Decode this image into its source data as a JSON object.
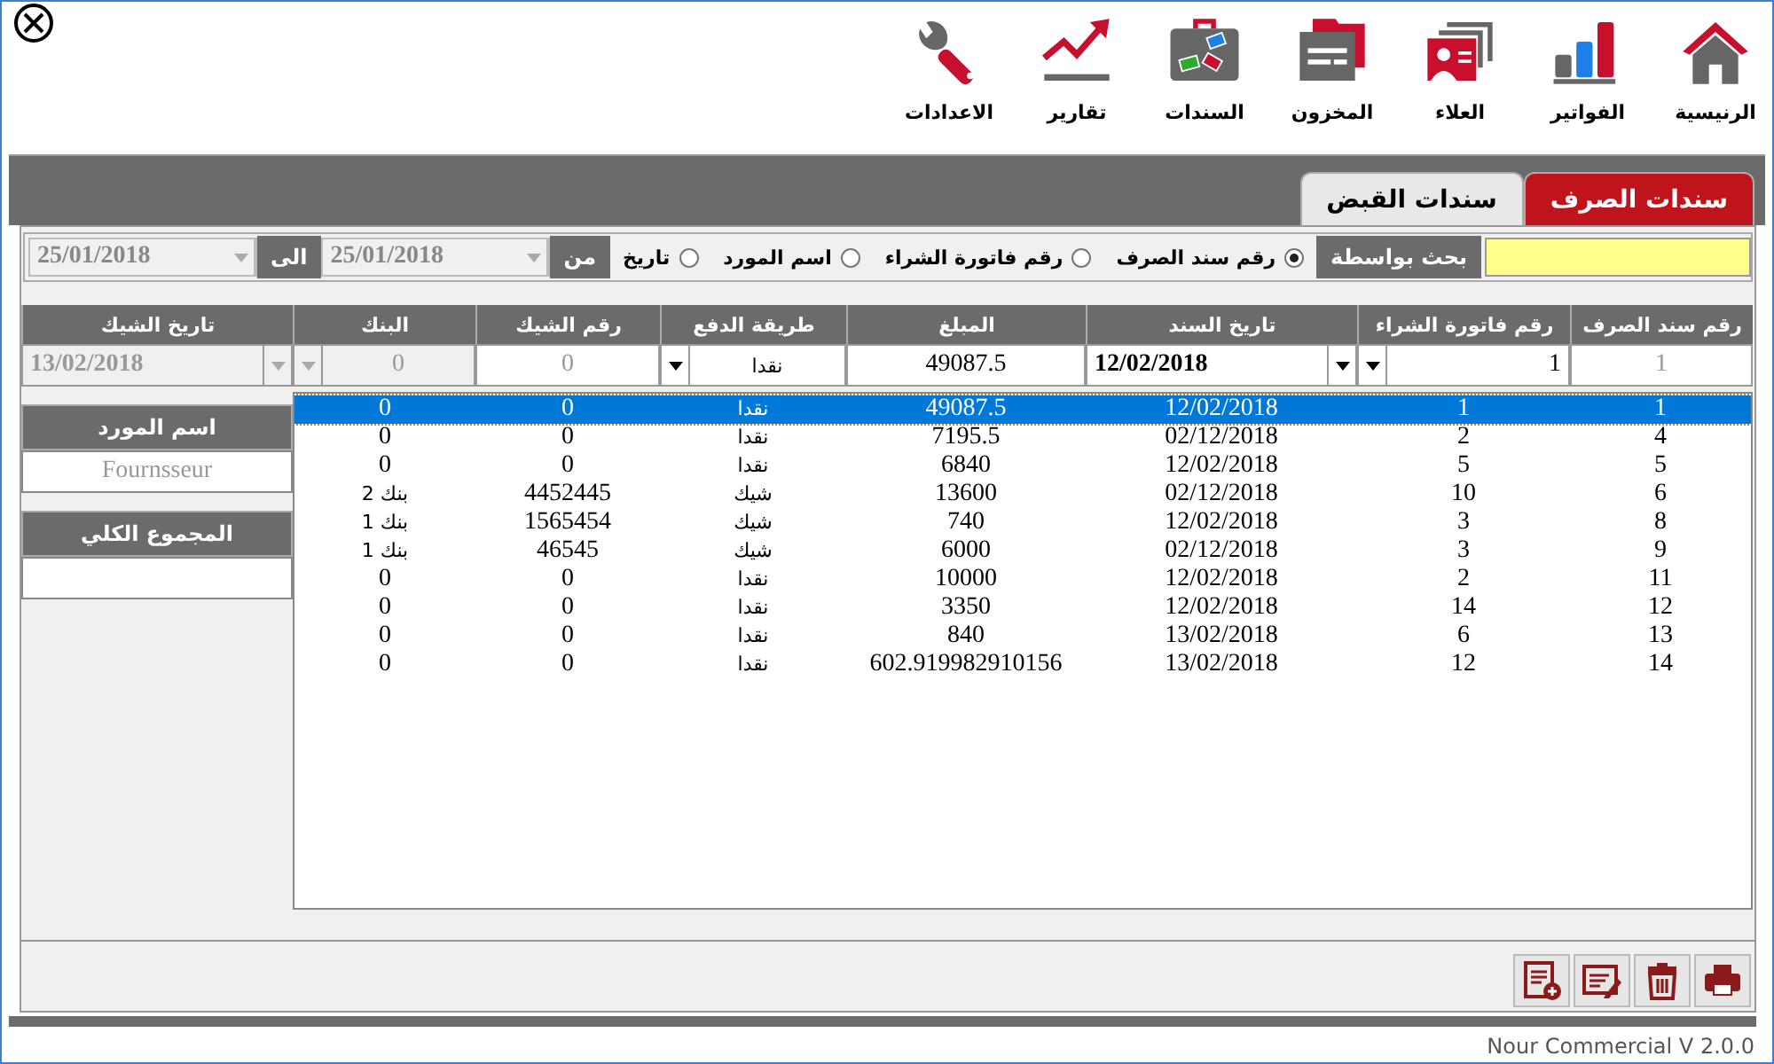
{
  "toolbar": [
    {
      "kind": "home",
      "label": "الرنيسية"
    },
    {
      "kind": "bars",
      "label": "الفواتير"
    },
    {
      "kind": "contact",
      "label": "العلاء"
    },
    {
      "kind": "folder",
      "label": "المخزون"
    },
    {
      "kind": "case",
      "label": "السندات"
    },
    {
      "kind": "trend",
      "label": "تقارير"
    },
    {
      "kind": "wrench",
      "label": "الاعدادات"
    }
  ],
  "tabs": [
    {
      "label": "سندات الصرف",
      "selected": true
    },
    {
      "label": "سندات القبض",
      "selected": false
    }
  ],
  "search": {
    "label": "بحث بواسطة",
    "options": [
      {
        "label": "رقم سند الصرف",
        "selected": true
      },
      {
        "label": "رقم فاتورة الشراء",
        "selected": false
      },
      {
        "label": "اسم المورد",
        "selected": false
      },
      {
        "label": "تاريخ",
        "selected": false
      }
    ],
    "from_label": "من",
    "from_date": "25/01/2018",
    "to_label": "الى",
    "to_date": "25/01/2018",
    "dates_disabled": true
  },
  "form": {
    "columns": [
      "رقم سند الصرف",
      "رقم فاتورة الشراء",
      "تاريخ السند",
      "المبلغ",
      "طريقة الدفع",
      "رقم الشيك",
      "البنك",
      "تاريخ الشيك"
    ],
    "fields": [
      {
        "kind": "text",
        "value": "1",
        "disabled": true
      },
      {
        "kind": "combo",
        "value": "1",
        "disabled": false
      },
      {
        "kind": "combo",
        "value": "12/02/2018",
        "disabled": false
      },
      {
        "kind": "text",
        "value": "49087.5",
        "disabled": false
      },
      {
        "kind": "combo",
        "value": "نقدا",
        "disabled": false
      },
      {
        "kind": "text",
        "value": "0",
        "disabled": true
      },
      {
        "kind": "combo",
        "value": "0",
        "disabled": true
      },
      {
        "kind": "combo",
        "value": "13/02/2018",
        "disabled": true
      }
    ]
  },
  "side": [
    {
      "label": "اسم المورد",
      "placeholder": "Fournsseur"
    },
    {
      "label": "المجموع الكلي"
    }
  ],
  "table": {
    "rows": [
      {
        "selected": true,
        "cells": [
          "1",
          "1",
          "12/02/2018",
          "49087.5",
          "نقدا",
          "0",
          "0"
        ]
      },
      {
        "selected": false,
        "cells": [
          "4",
          "2",
          "02/12/2018",
          "7195.5",
          "نقدا",
          "0",
          "0"
        ]
      },
      {
        "selected": false,
        "cells": [
          "5",
          "5",
          "12/02/2018",
          "6840",
          "نقدا",
          "0",
          "0"
        ]
      },
      {
        "selected": false,
        "cells": [
          "6",
          "10",
          "02/12/2018",
          "13600",
          "شيك",
          "4452445",
          "بنك 2"
        ]
      },
      {
        "selected": false,
        "cells": [
          "8",
          "3",
          "12/02/2018",
          "740",
          "شيك",
          "1565454",
          "بنك 1"
        ]
      },
      {
        "selected": false,
        "cells": [
          "9",
          "3",
          "02/12/2018",
          "6000",
          "شيك",
          "46545",
          "بنك 1"
        ]
      },
      {
        "selected": false,
        "cells": [
          "11",
          "2",
          "12/02/2018",
          "10000",
          "نقدا",
          "0",
          "0"
        ]
      },
      {
        "selected": false,
        "cells": [
          "12",
          "14",
          "12/02/2018",
          "3350",
          "نقدا",
          "0",
          "0"
        ]
      },
      {
        "selected": false,
        "cells": [
          "13",
          "6",
          "13/02/2018",
          "840",
          "نقدا",
          "0",
          "0"
        ]
      },
      {
        "selected": false,
        "cells": [
          "14",
          "12",
          "13/02/2018",
          "602.919982910156",
          "نقدا",
          "0",
          "0"
        ]
      }
    ]
  },
  "actions": [
    {
      "kind": "print"
    },
    {
      "kind": "delete"
    },
    {
      "kind": "edit"
    },
    {
      "kind": "add"
    }
  ],
  "status_bar": "Nour Commercial V 2.0.0"
}
